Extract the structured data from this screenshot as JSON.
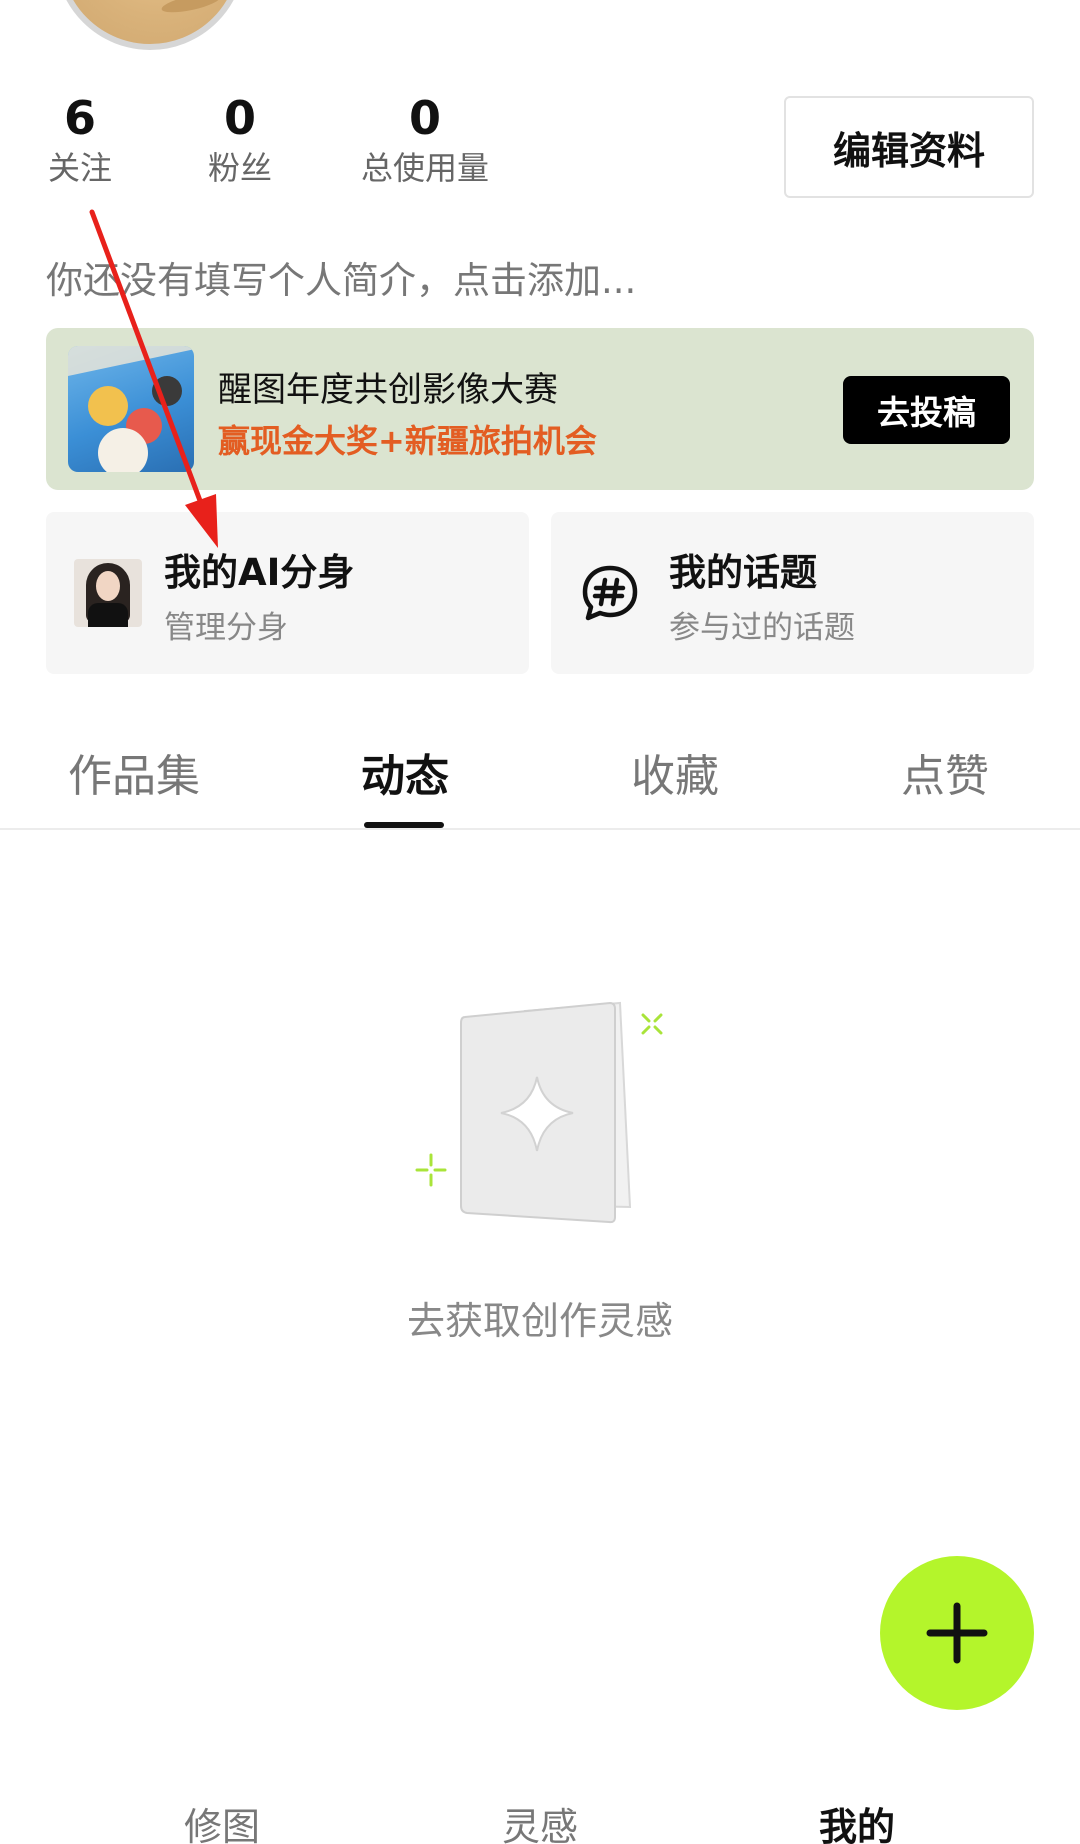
{
  "profile": {
    "stats": [
      {
        "value": "6",
        "label": "关注"
      },
      {
        "value": "0",
        "label": "粉丝"
      },
      {
        "value": "0",
        "label": "总使用量"
      }
    ],
    "edit_label": "编辑资料",
    "bio_placeholder": "你还没有填写个人简介，点击添加..."
  },
  "banner": {
    "title": "醒图年度共创影像大赛",
    "subtitle": "赢现金大奖+新疆旅拍机会",
    "button_label": "去投稿",
    "subtitle_color": "#e35d22",
    "background_color": "#dbe4d0"
  },
  "cards": {
    "ai": {
      "title": "我的AI分身",
      "subtitle": "管理分身"
    },
    "topic": {
      "title": "我的话题",
      "subtitle": "参与过的话题"
    }
  },
  "tabs": [
    {
      "label": "作品集",
      "active": false
    },
    {
      "label": "动态",
      "active": true
    },
    {
      "label": "收藏",
      "active": false
    },
    {
      "label": "点赞",
      "active": false
    }
  ],
  "empty_state": {
    "text": "去获取创作灵感"
  },
  "fab": {
    "icon": "plus-icon",
    "color": "#b4f52b"
  },
  "bottom_nav": [
    {
      "label": "修图",
      "active": false
    },
    {
      "label": "灵感",
      "active": false
    },
    {
      "label": "我的",
      "active": true
    }
  ],
  "annotation": {
    "icon": "red-arrow",
    "color": "#e8211b"
  }
}
